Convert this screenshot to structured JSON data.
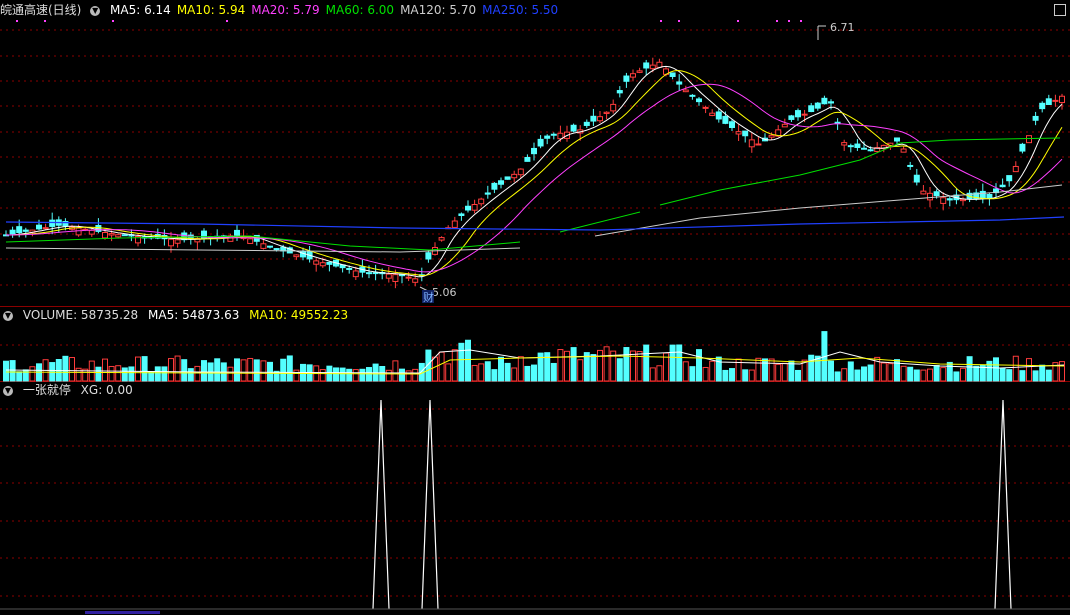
{
  "price_panel": {
    "title": "皖通高速(日线)",
    "ma_labels": [
      {
        "text": "MA5: 6.14",
        "color": "#ffffff"
      },
      {
        "text": "MA10: 5.94",
        "color": "#ffff00"
      },
      {
        "text": "MA20: 5.79",
        "color": "#ff40ff"
      },
      {
        "text": "MA60: 6.00",
        "color": "#00e000"
      },
      {
        "text": "MA120: 5.70",
        "color": "#cccccc"
      },
      {
        "text": "MA250: 5.50",
        "color": "#2040ff"
      }
    ],
    "high_annotation": "6.71",
    "low_annotation": "5.06",
    "finance_marker": "财"
  },
  "volume_panel": {
    "title": "VOLUME: 58735.28",
    "ma5": "MA5: 54873.63",
    "ma10": "MA10: 49552.23"
  },
  "indicator_panel": {
    "title": "一张就停",
    "xg": "XG: 0.00"
  },
  "colors": {
    "up": "#ff3c3c",
    "down": "#54ffff",
    "grid": "#8b0000",
    "background": "#000000"
  }
}
